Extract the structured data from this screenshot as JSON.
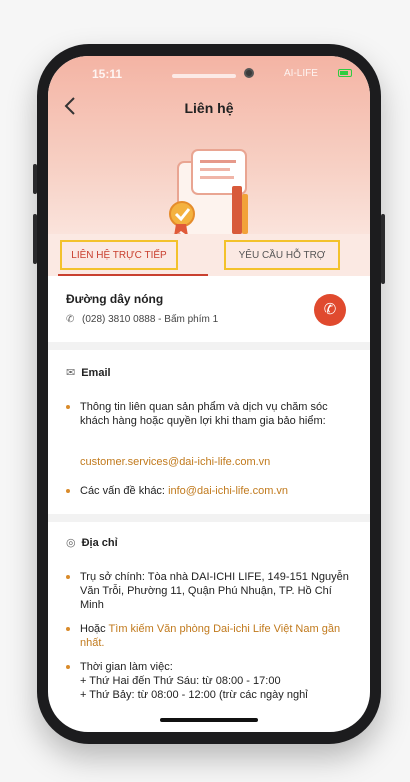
{
  "statusbar": {
    "time": "15:11",
    "network": "AI-LIFE"
  },
  "header": {
    "title": "Liên hệ",
    "back_icon": "chevron-left-icon"
  },
  "tabs": [
    {
      "label": "LIÊN HỆ TRỰC TIẾP",
      "active": true
    },
    {
      "label": "YÊU CẦU HỖ TRỢ",
      "active": false
    }
  ],
  "hotline": {
    "title": "Đường dây nóng",
    "phone": "(028) 3810 0888 - Bấm phím 1"
  },
  "email": {
    "heading": "Email",
    "item1": "Thông tin liên quan sản phẩm và dịch vụ chăm sóc khách hàng hoặc quyền lợi khi tham gia bảo hiểm:",
    "item1_link": "customer.services@dai-ichi-life.com.vn",
    "item2_prefix": "Các vấn đề khác: ",
    "item2_link": "info@dai-ichi-life.com.vn"
  },
  "address": {
    "heading": "Địa chỉ",
    "item1": "Trụ sở chính: Tòa nhà DAI-ICHI LIFE, 149-151 Nguyễn Văn Trỗi, Phường 11, Quận Phú Nhuận, TP. Hồ Chí Minh",
    "item2_prefix": "Hoặc ",
    "item2_link": "Tìm kiếm Văn phòng Dai-ichi Life Việt Nam gần nhất.",
    "item3_title": "Thời gian làm việc:",
    "item3_line1": "+ Thứ Hai đến Thứ Sáu: từ 08:00 - 17:00",
    "item3_line2": "+ Thứ Bảy: từ 08:00 - 12:00 (trừ các ngày nghỉ"
  },
  "colors": {
    "accent": "#c9402f",
    "link": "#c17a1d",
    "highlight_box": "#f3c22b",
    "call_button": "#e04a2e"
  }
}
